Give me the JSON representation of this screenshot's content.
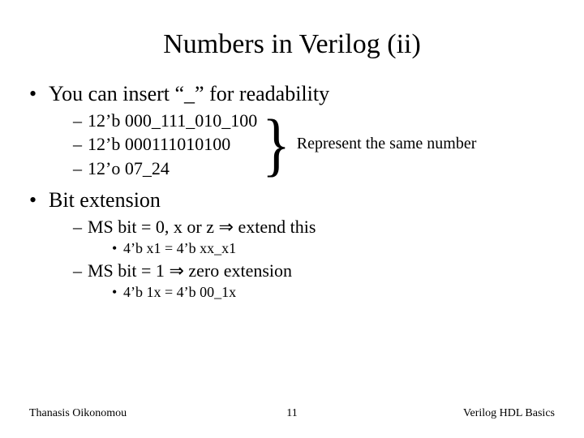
{
  "title": "Numbers in Verilog (ii)",
  "bullets": {
    "readability": {
      "text": "You can insert “_” for readability",
      "examples": [
        "12’b 000_111_010_100",
        "12’b 000111010100",
        "12’o 07_24"
      ],
      "brace_label": "Represent the same number"
    },
    "bitext": {
      "text": "Bit extension",
      "sub": [
        {
          "text_pre": "MS bit = 0, x or z ",
          "text_post": " extend this",
          "ex": "4’b x1 = 4’b xx_x1"
        },
        {
          "text_pre": "MS bit = 1 ",
          "text_post": " zero extension",
          "ex": "4’b 1x = 4’b 00_1x"
        }
      ]
    }
  },
  "implies_glyph": "⇒",
  "footer": {
    "left": "Thanasis Oikonomou",
    "center": "11",
    "right": "Verilog HDL Basics"
  }
}
